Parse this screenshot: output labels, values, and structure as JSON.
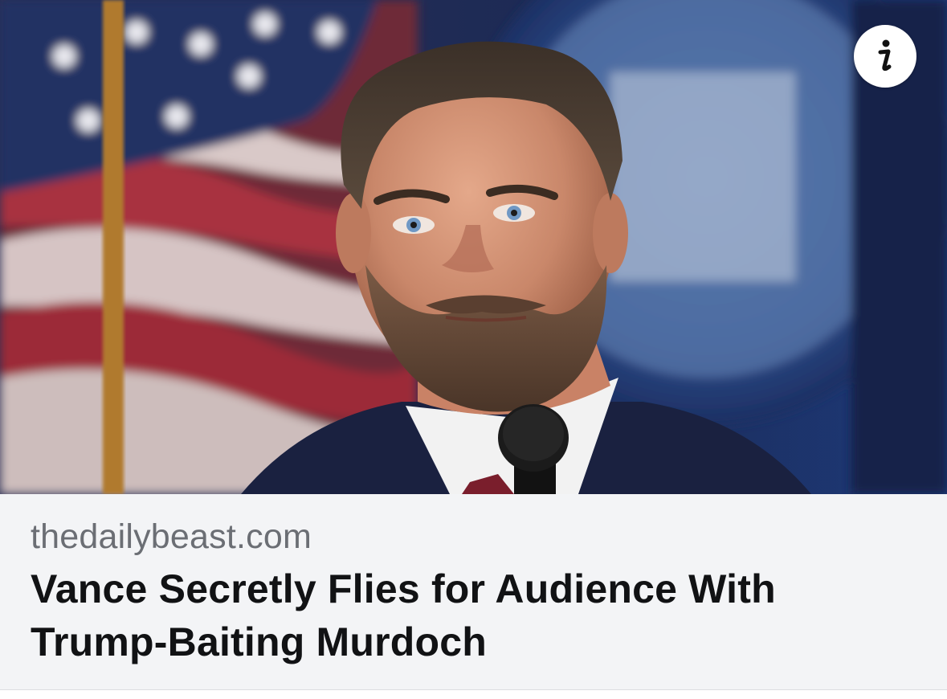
{
  "link_preview": {
    "image_alt": "Man with beard speaking at a microphone in front of an American flag and a blue seal",
    "domain": "thedailybeast.com",
    "headline_line1": "Vance Secretly Flies for Audience With",
    "headline_line2": "Trump-Baiting Murdoch",
    "info_button_icon": "info-icon"
  },
  "colors": {
    "card_background": "#f3f4f6",
    "domain_text": "#6b6e74",
    "headline_text": "#111214",
    "info_button_background": "#ffffff"
  }
}
